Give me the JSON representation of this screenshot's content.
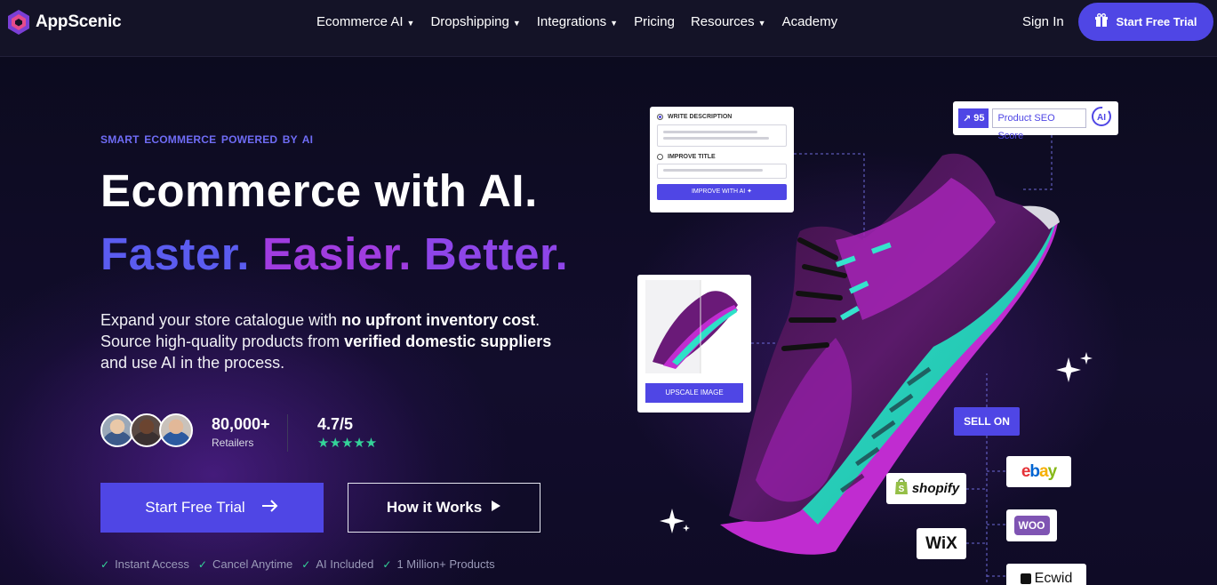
{
  "brand": {
    "name": "AppScenic"
  },
  "nav": {
    "items": [
      {
        "label": "Ecommerce AI",
        "has_dropdown": true
      },
      {
        "label": "Dropshipping",
        "has_dropdown": true
      },
      {
        "label": "Integrations",
        "has_dropdown": true
      },
      {
        "label": "Pricing",
        "has_dropdown": false
      },
      {
        "label": "Resources",
        "has_dropdown": true
      },
      {
        "label": "Academy",
        "has_dropdown": false
      }
    ],
    "sign_in": "Sign In",
    "cta": "Start Free Trial"
  },
  "hero": {
    "eyebrow": "SMART  ECOMMERCE  POWERED BY AI",
    "headline": "Ecommerce with AI.",
    "subline": [
      "Faster.",
      "Easier.",
      "Better."
    ],
    "desc_parts": [
      "Expand your store catalogue with ",
      "no upfront inventory cost",
      ". Source high-quality products from ",
      "verified domestic suppliers",
      " and use AI in the process."
    ],
    "stat_retailers_value": "80,000+",
    "stat_retailers_label": "Retailers",
    "stat_rating_value": "4.7/5",
    "stat_rating_stars": "★★★★★",
    "primary_cta": "Start Free Trial",
    "secondary_cta": "How it Works",
    "features": [
      "Instant Access",
      "Cancel Anytime",
      "AI Included",
      "1 Million+ Products"
    ]
  },
  "visual": {
    "write_description": "WRITE DESCRIPTION",
    "improve_title": "IMPROVE TITLE",
    "improve_with_ai": "IMPROVE WITH AI ✦",
    "seo_score": "95",
    "seo_label": "Product SEO Score",
    "upscale_image": "UPSCALE IMAGE",
    "sell_on": "SELL ON",
    "platforms": [
      "shopify",
      "ebay",
      "WOO",
      "WiX",
      "Ecwid"
    ]
  },
  "colors": {
    "accent": "#4f46e5",
    "faster": "#5b5cf0",
    "easier": "#a03ce0",
    "better": "#8e45e8",
    "check": "#34d399"
  }
}
